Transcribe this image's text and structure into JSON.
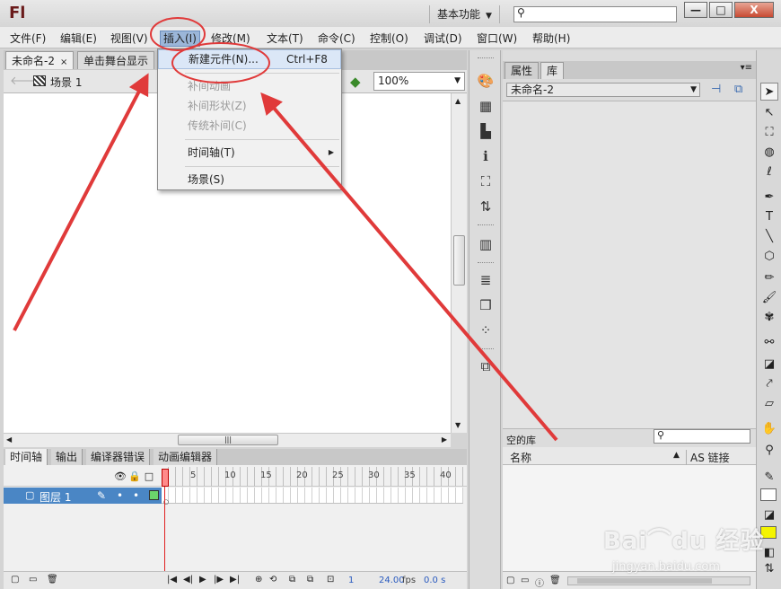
{
  "app": {
    "logo": "Fl",
    "workspace": "基本功能",
    "help_search_placeholder": ""
  },
  "window_buttons": {
    "minimize": "—",
    "maximize": "□",
    "close": "X"
  },
  "menu": [
    "文件(F)",
    "编辑(E)",
    "视图(V)",
    "插入(I)",
    "修改(M)",
    "文本(T)",
    "命令(C)",
    "控制(O)",
    "调试(D)",
    "窗口(W)",
    "帮助(H)"
  ],
  "insert_menu": {
    "new_symbol": "新建元件(N)...",
    "new_symbol_shortcut": "Ctrl+F8",
    "motion_tween": "补间动画",
    "shape_tween": "补间形状(Z)",
    "classic_tween": "传统补间(C)",
    "timeline": "时间轴(T)",
    "scene": "场景(S)"
  },
  "document_tabs": [
    {
      "label": "未命名-2",
      "close": "×"
    },
    {
      "label": "单击舞台显示"
    }
  ],
  "edit_bar": {
    "scene": "场景 1",
    "zoom": "100%"
  },
  "timeline": {
    "tabs": [
      "时间轴",
      "输出",
      "编译器错误",
      "动画编辑器"
    ],
    "ruler": [
      "1",
      "5",
      "10",
      "15",
      "20",
      "25",
      "30",
      "35",
      "40"
    ],
    "layer_name": "图层 1",
    "current_frame": "1",
    "fps": "24.00",
    "fps_unit": "fps",
    "time": "0.0 s"
  },
  "library": {
    "tabs": [
      "属性",
      "库"
    ],
    "document": "未命名-2",
    "empty_text": "空的库",
    "col_name": "名称",
    "col_linkage": "AS 链接"
  },
  "watermark": {
    "logo": "Bai⌒du 经验",
    "url": "jingyan.baidu.com"
  },
  "colors": {
    "annotation": "#e03a3a",
    "selection": "#4a86c5",
    "fill_swatch": "#f4f400"
  }
}
